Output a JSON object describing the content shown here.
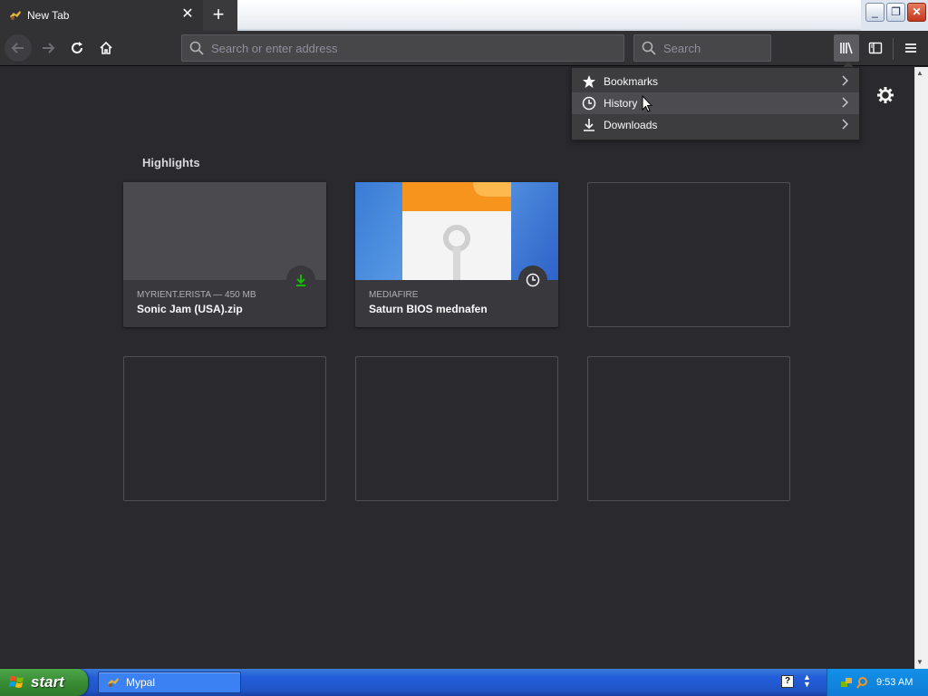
{
  "browser": {
    "tab": {
      "title": "New Tab",
      "close": "✕"
    },
    "new_tab_symbol": "+",
    "window_controls": {
      "minimize": "_",
      "maximize": "❐",
      "close": "✕"
    },
    "nav": {
      "urlbar_placeholder": "Search or enter address",
      "searchbar_placeholder": "Search"
    }
  },
  "library_menu": {
    "items": [
      {
        "label": "Bookmarks",
        "icon": "star-icon"
      },
      {
        "label": "History",
        "icon": "clock-icon"
      },
      {
        "label": "Downloads",
        "icon": "download-icon"
      }
    ]
  },
  "highlights": {
    "title": "Highlights",
    "cards": [
      {
        "meta": "MYRIENT.ERISTA — 450 MB",
        "title": "Sonic Jam (USA).zip",
        "badge": "download-icon",
        "badge_color": "#12bc00"
      },
      {
        "meta": "MEDIAFIRE",
        "title": "Saturn BIOS mednafen",
        "badge": "clock-icon"
      }
    ]
  },
  "taskbar": {
    "start_label": "start",
    "window_item": "Mypal",
    "clock": "9:53 AM",
    "help": "?"
  },
  "colors": {
    "accent_green": "#12bc00",
    "content_bg": "#2a2a2e",
    "toolbar_bg": "#323234"
  }
}
